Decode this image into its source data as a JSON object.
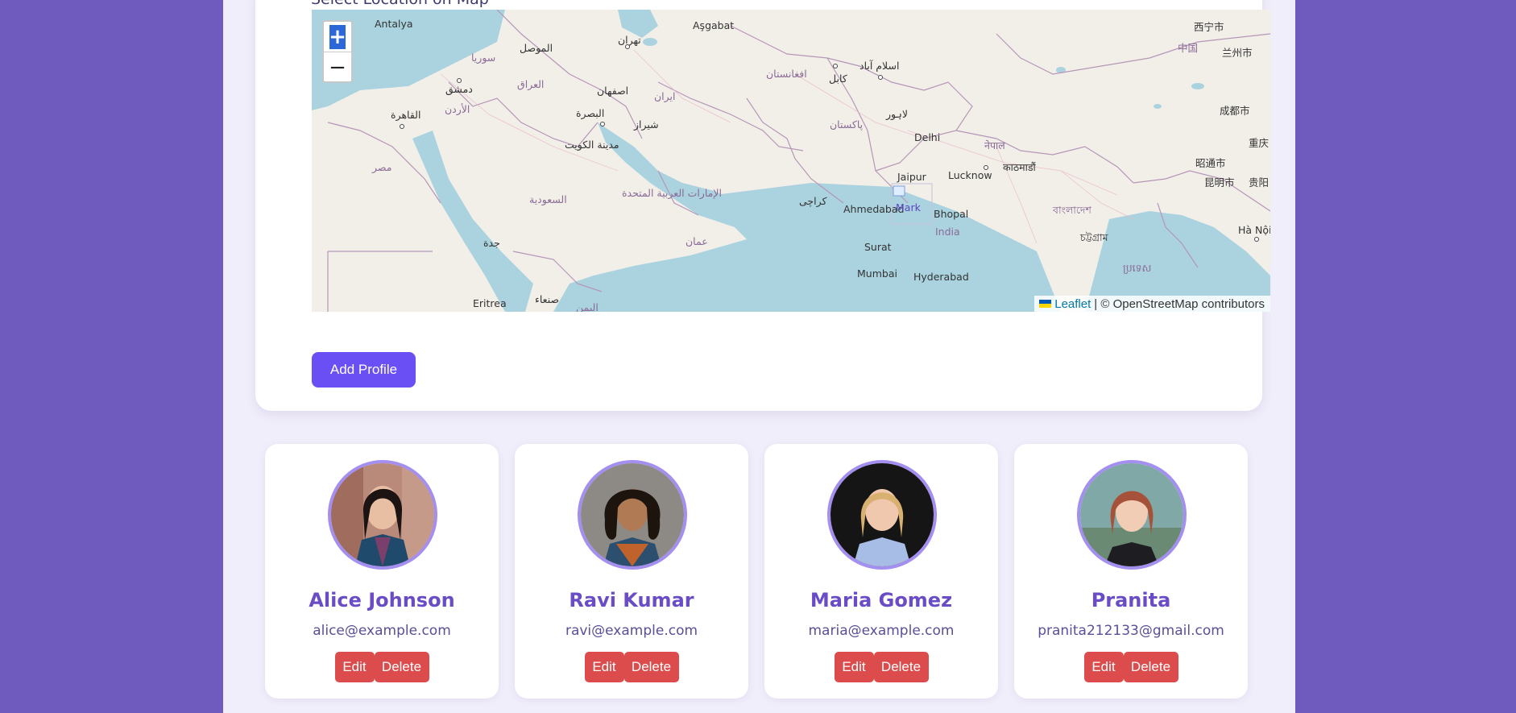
{
  "form": {
    "map_label": "Select Location on Map",
    "zoom_in": "+",
    "zoom_out": "−",
    "attribution_link": "Leaflet",
    "attribution_text": "| © OpenStreetMap contributors",
    "marker_alt": "Mark",
    "add_button": "Add Profile"
  },
  "map_places": [
    "Antalya",
    "Aşgabat",
    "الموصل",
    "سوريا",
    "دمشق",
    "العراق",
    "القاهرة",
    "الأردن",
    "اصفهان",
    "ایران",
    "البصرة",
    "شيراز",
    "مدينة الكويت",
    "مصر",
    "الإمارات العربية المتحدة",
    "السعودية",
    "جدة",
    "عمان",
    "Eritrea",
    "صنعاء",
    "اليمن",
    "تهران",
    "افغانستان",
    "کابل",
    "اسلام آباد",
    "لاہور",
    "پاکستان",
    "کراچی",
    "Delhi",
    "Jaipur",
    "Lucknow",
    "नेपाल",
    "काठमाडौं",
    "Ahmedabad",
    "Bhopal",
    "India",
    "Surat",
    "Mumbai",
    "Hyderabad",
    "বাংলাদেশ",
    "চট্টগ্রাম",
    "ប្រទេស",
    "中国",
    "西宁市",
    "兰州市",
    "成都市",
    "重庆",
    "昭通市",
    "昆明市",
    "贵阳",
    "Hà Nội"
  ],
  "profiles": [
    {
      "name": "Alice Johnson",
      "email": "alice@example.com",
      "edit": "Edit",
      "delete": "Delete"
    },
    {
      "name": "Ravi Kumar",
      "email": "ravi@example.com",
      "edit": "Edit",
      "delete": "Delete"
    },
    {
      "name": "Maria Gomez",
      "email": "maria@example.com",
      "edit": "Edit",
      "delete": "Delete"
    },
    {
      "name": "Pranita",
      "email": "pranita212133@gmail.com",
      "edit": "Edit",
      "delete": "Delete"
    }
  ],
  "colors": {
    "page_background": "#6f5bbd",
    "accent": "#6a4ff5",
    "danger": "#dc4c4c",
    "name_text": "#6a4cc7"
  }
}
